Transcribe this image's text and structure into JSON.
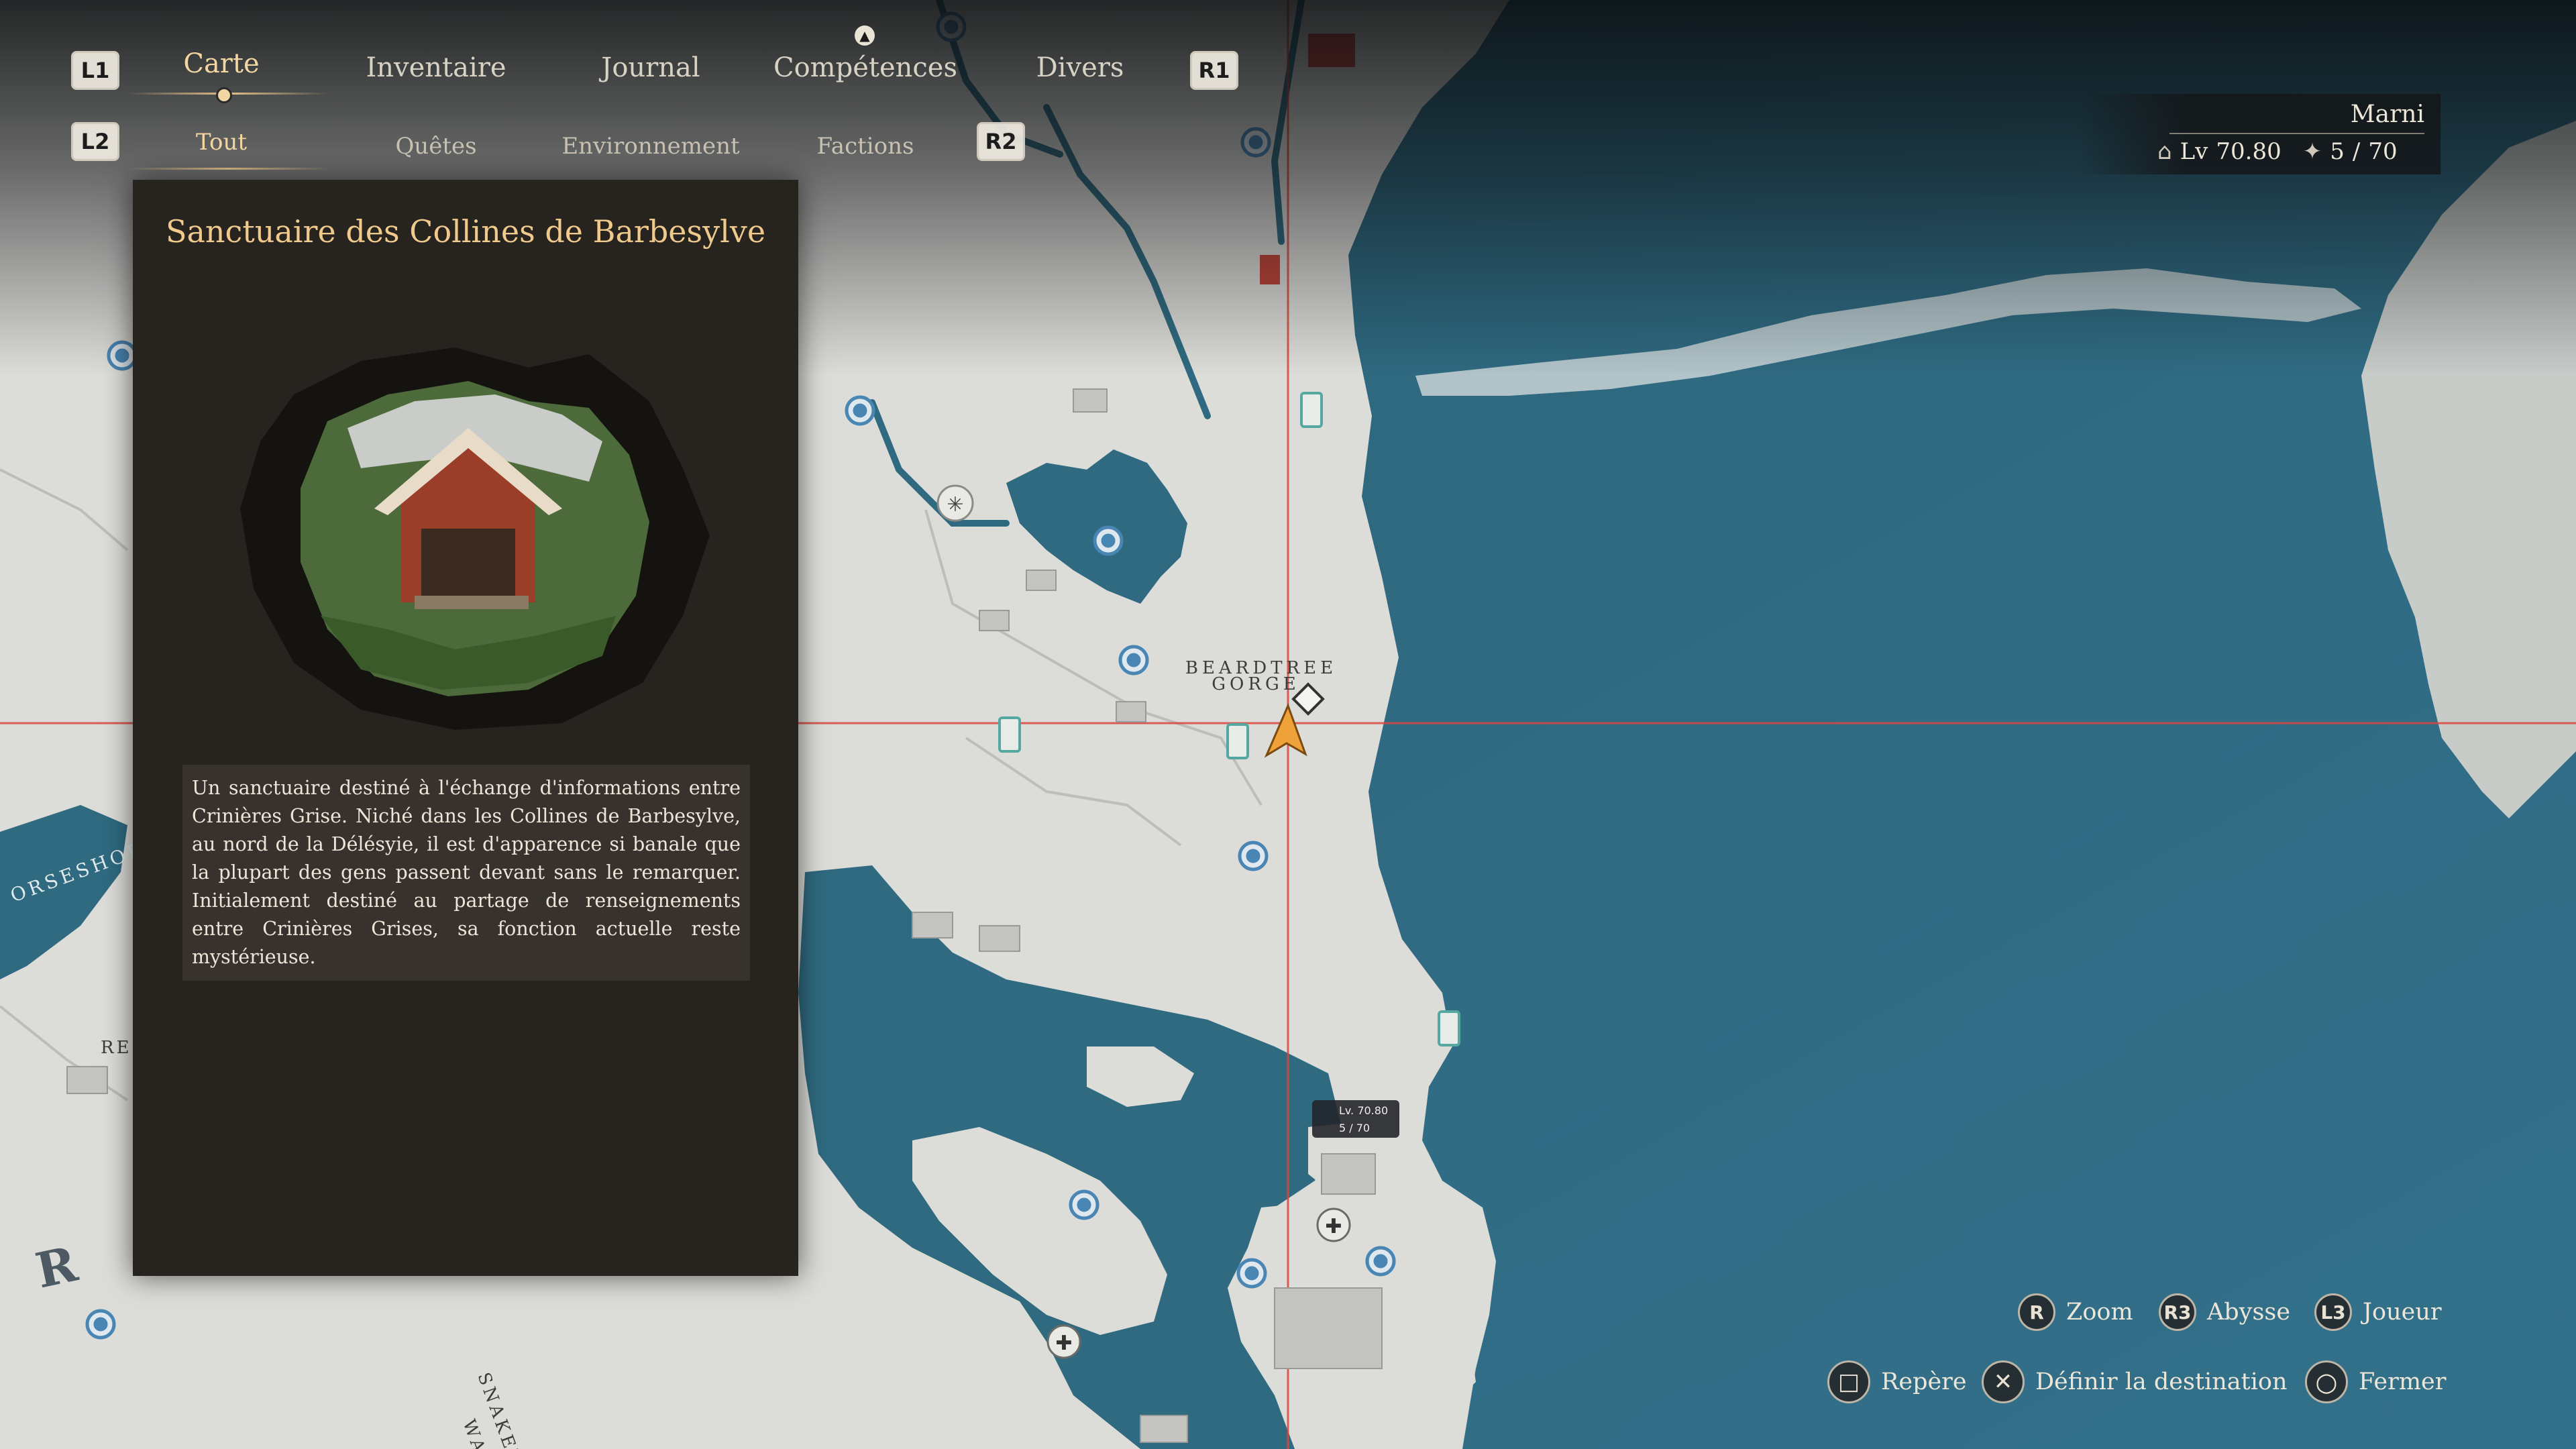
{
  "nav": {
    "left_shoulder": "L1",
    "right_shoulder": "R1",
    "tabs": [
      {
        "label": "Carte",
        "active": true
      },
      {
        "label": "Inventaire",
        "active": false
      },
      {
        "label": "Journal",
        "active": false
      },
      {
        "label": "Compétences",
        "active": false
      },
      {
        "label": "Divers",
        "active": false
      }
    ]
  },
  "subnav": {
    "left_trigger": "L2",
    "right_trigger": "R2",
    "tabs": [
      {
        "label": "Tout",
        "active": true
      },
      {
        "label": "Quêtes",
        "active": false
      },
      {
        "label": "Environnement",
        "active": false
      },
      {
        "label": "Factions",
        "active": false
      }
    ]
  },
  "panel": {
    "title": "Sanctuaire des Collines de Barbesylve",
    "description": "Un sanctuaire destiné à l'échange d'informations entre Crinières Grise. Niché dans les Collines de Barbesylve, au nord de la Délésyie, il est d'apparence si banale que la plupart des gens passent devant sans le remarquer. Initialement destiné au partage de renseignements entre Crinières Grises, sa fonction actuelle reste mystérieuse."
  },
  "player": {
    "name": "Marni",
    "level_prefix": "Lv",
    "level": "70.80",
    "abyss_current": "5",
    "abyss_separator": "/",
    "abyss_max": "70"
  },
  "map_labels": {
    "gorge_line1": "BEARDTREE",
    "gorge_line2": "GORGE",
    "horseshoe": "ORSESHOE L",
    "snake": "SNAKET",
    "snake2": "WAL",
    "region_r": "R",
    "region_re": "RE",
    "marker_level": "Lv. 70.80",
    "marker_abyss": "5 / 70"
  },
  "controls": [
    {
      "glyph": "R",
      "label": "Zoom"
    },
    {
      "glyph": "R3",
      "label": "Abysse"
    },
    {
      "glyph": "L3",
      "label": "Joueur"
    },
    {
      "glyph": "□",
      "label": "Repère"
    },
    {
      "glyph": "✕",
      "label": "Définir la destination"
    },
    {
      "glyph": "○",
      "label": "Fermer"
    }
  ],
  "colors": {
    "sea": "#2f6a80",
    "land": "#dcdcd8",
    "accent_gold": "#f0c98c",
    "crosshair": "#d9473e"
  },
  "icons": [
    "shrine-icon",
    "waypoint-icon",
    "player-arrow-icon",
    "town-icon",
    "tree-icon",
    "dpad-icon"
  ]
}
